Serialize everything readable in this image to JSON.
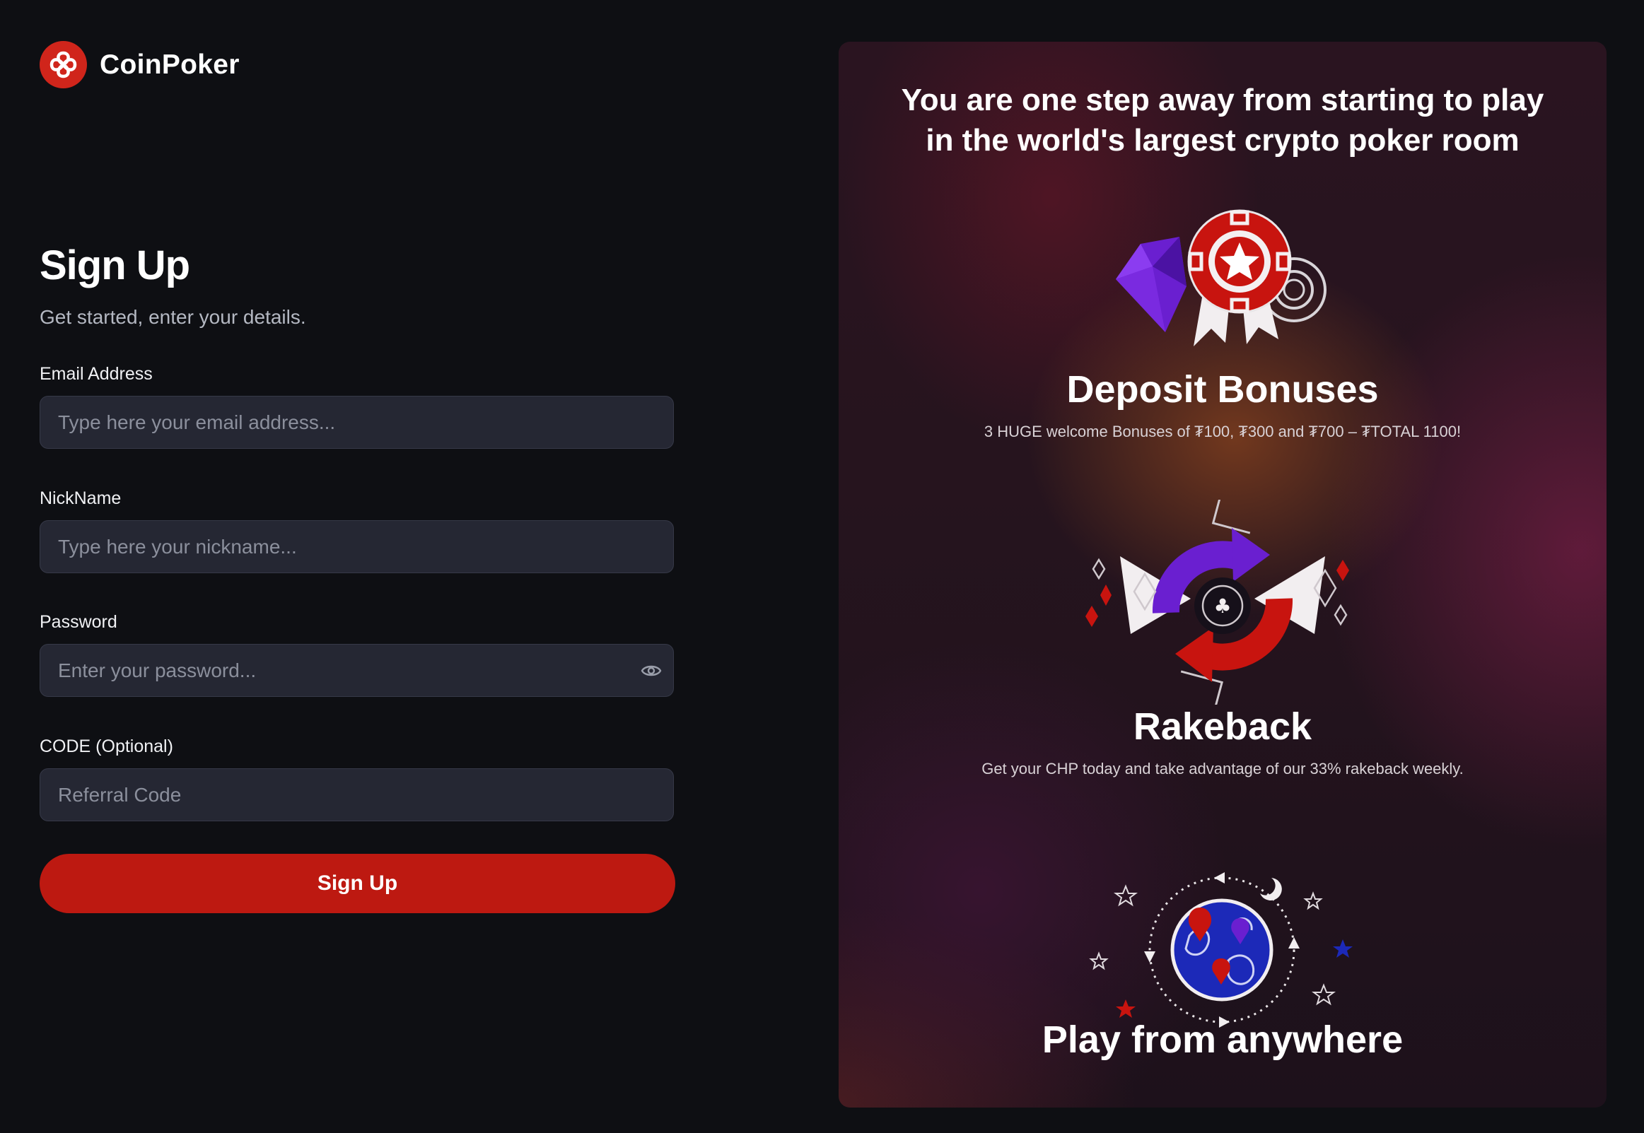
{
  "brand": {
    "name": "CoinPoker",
    "accent_color": "#bd1911"
  },
  "form": {
    "title": "Sign Up",
    "subtitle": "Get started, enter your details.",
    "email": {
      "label": "Email Address",
      "placeholder": "Type here your email address...",
      "value": ""
    },
    "nickname": {
      "label": "NickName",
      "placeholder": "Type here your nickname...",
      "value": ""
    },
    "password": {
      "label": "Password",
      "placeholder": "Enter your password...",
      "value": "",
      "toggle_icon": "eye-icon"
    },
    "code": {
      "label": "CODE (Optional)",
      "placeholder": "Referral Code",
      "value": ""
    },
    "submit_label": "Sign Up"
  },
  "promo": {
    "heading_line1": "You are one step away from starting to play",
    "heading_line2": "in the world's largest crypto poker room",
    "features": [
      {
        "icon": "trophy-chip-icon",
        "title": "Deposit Bonuses",
        "description": "3 HUGE welcome Bonuses of ₮100, ₮300 and ₮700 – ₮TOTAL 1100!"
      },
      {
        "icon": "rakeback-cycle-icon",
        "title": "Rakeback",
        "description": "Get your CHP today and take advantage of our 33% rakeback weekly."
      },
      {
        "icon": "globe-icon",
        "title": "Play from anywhere",
        "description": ""
      }
    ]
  }
}
